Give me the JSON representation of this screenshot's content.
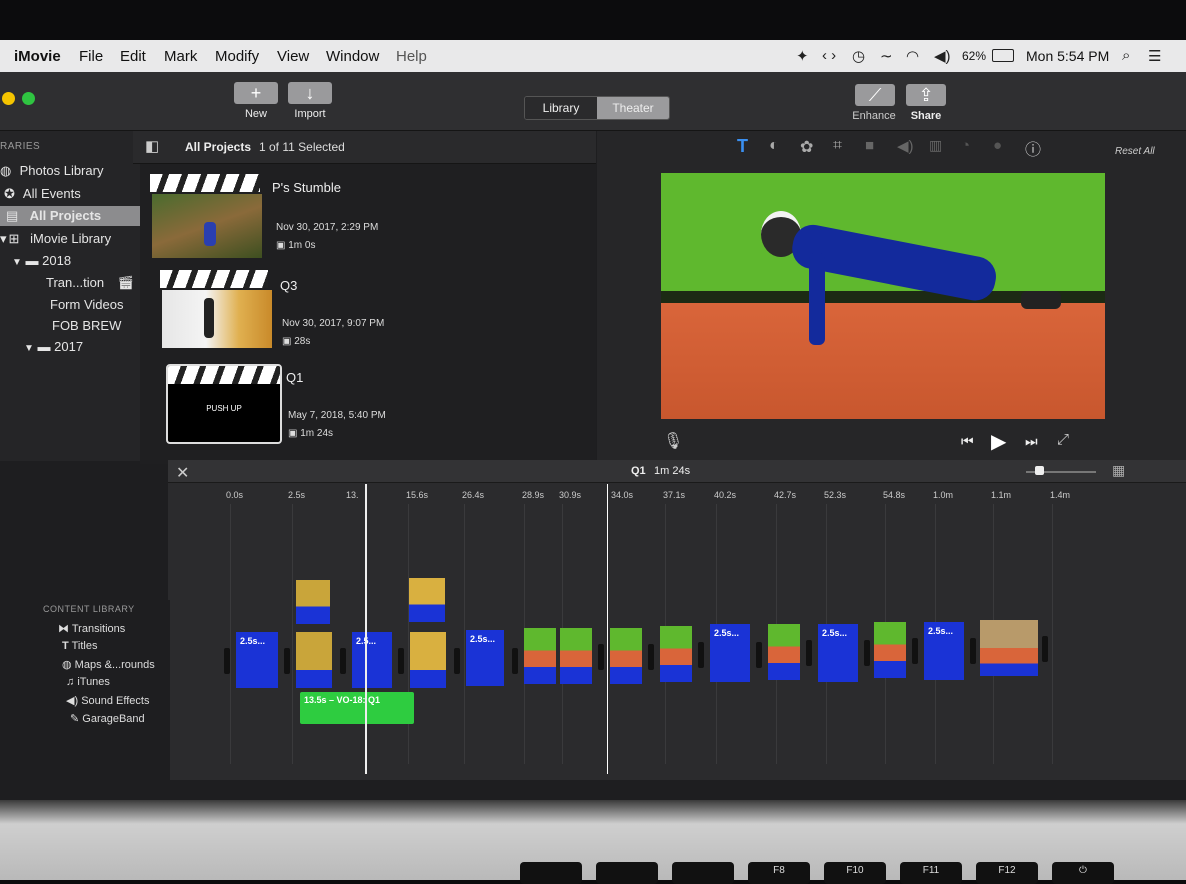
{
  "menubar": {
    "app": "iMovie",
    "items": [
      "File",
      "Edit",
      "Mark",
      "Modify",
      "View",
      "Window",
      "Help"
    ],
    "battery": "62%",
    "clock": "Mon 5:54 PM"
  },
  "toolbar": {
    "new_label": "New",
    "import_label": "Import",
    "library_tab": "Library",
    "theater_tab": "Theater",
    "enhance_label": "Enhance",
    "share_label": "Share"
  },
  "sidebar": {
    "header": "RARIES",
    "items": [
      {
        "label": "Photos Library",
        "icon": "photos-icon"
      },
      {
        "label": "All Events",
        "icon": "star-icon"
      },
      {
        "label": "All Projects",
        "icon": "film-icon"
      },
      {
        "label": "iMovie Library",
        "icon": "grid-icon"
      },
      {
        "label": "2018",
        "icon": "folder-icon"
      },
      {
        "label": "Tran...tion",
        "icon": "clapper-icon"
      },
      {
        "label": "Form Videos",
        "icon": ""
      },
      {
        "label": "FOB BREW",
        "icon": ""
      },
      {
        "label": "2017",
        "icon": "folder-icon"
      }
    ]
  },
  "browser": {
    "title": "All Projects",
    "selection": "1 of 11 Selected",
    "projects": [
      {
        "title": "P's Stumble",
        "date": "Nov 30, 2017, 2:29 PM",
        "duration": "1m 0s"
      },
      {
        "title": "Q3",
        "date": "Nov 30, 2017, 9:07 PM",
        "duration": "28s"
      },
      {
        "title": "Q1",
        "date": "May 7, 2018, 5:40 PM",
        "duration": "1m 24s",
        "thumb_text": "PUSH UP"
      }
    ]
  },
  "viewer": {
    "reset_label": "Reset All"
  },
  "timeline": {
    "title": "Q1",
    "duration": "1m 24s",
    "ticks": [
      "0.0s",
      "2.5s",
      "13.",
      "15.6s",
      "26.4s",
      "28.9s",
      "30.9s",
      "34.0s",
      "37.1s",
      "40.2s",
      "42.7s",
      "52.3s",
      "54.8s",
      "1.0m",
      "1.1m",
      "1.4m"
    ],
    "clip_label": "2.5s...",
    "clip_label_short": "2.5...",
    "audio_label": "13.5s – VO-18: Q1"
  },
  "content_library": {
    "header": "CONTENT LIBRARY",
    "items": [
      {
        "label": "Transitions",
        "icon": "transitions-icon"
      },
      {
        "label": "Titles",
        "icon": "titles-icon"
      },
      {
        "label": "Maps &...rounds",
        "icon": "globe-icon"
      },
      {
        "label": "iTunes",
        "icon": "music-icon"
      },
      {
        "label": "Sound Effects",
        "icon": "speaker-icon"
      },
      {
        "label": "GarageBand",
        "icon": "guitar-icon"
      }
    ]
  },
  "keyboard": {
    "keys": [
      "F8",
      "F10",
      "F11",
      "F12"
    ]
  },
  "colors": {
    "clip_blue": "#1a33d6",
    "audio_green": "#2ecc40",
    "wall_green": "#5fb82e",
    "floor_orange": "#d9653a"
  }
}
